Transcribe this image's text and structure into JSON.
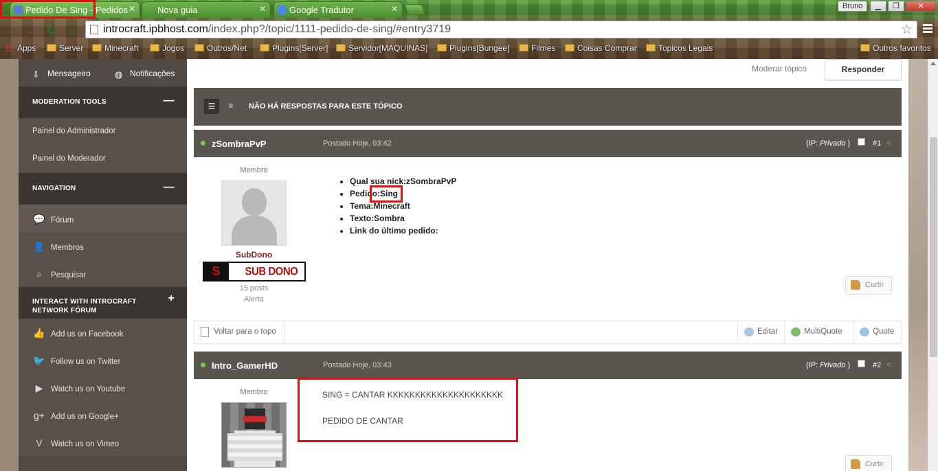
{
  "browser": {
    "tabs": [
      {
        "label": "Pedido De Sing - Pedidos",
        "active": true
      },
      {
        "label": "Nova guia",
        "active": false
      },
      {
        "label": "Google Tradutor",
        "active": false
      }
    ],
    "user": "Bruno",
    "window_buttons": {
      "minimize": "▁",
      "restore": "❐",
      "close": "✕"
    },
    "url_host": "introcraft.ipbhost.com",
    "url_path": "/index.php?/topic/1111-pedido-de-sing/#entry3719",
    "bookmarks": [
      "Apps",
      "Server",
      "Minecraft",
      "Jogos",
      "Outros/Net",
      "Plugins[Server]",
      "Servidor[MAQUINAS]",
      "Plugins[Bungee]",
      "Filmes",
      "Coisas Comprar",
      "Topicos Legais"
    ],
    "other_bookmarks": "Outros favoritos"
  },
  "sidebar": {
    "top_links": [
      {
        "label": "Mensageiro",
        "icon": "inbox-icon"
      },
      {
        "label": "Notificações",
        "icon": "globe-icon"
      }
    ],
    "moderation": {
      "title": "MODERATION TOOLS",
      "toggle": "—",
      "items": [
        "Painel do Administrador",
        "Painel do Moderador"
      ]
    },
    "navigation": {
      "title": "NAVIGATION",
      "toggle": "—",
      "items": [
        {
          "label": "Fórum",
          "icon": "chat-bubble-icon"
        },
        {
          "label": "Membros",
          "icon": "user-icon"
        },
        {
          "label": "Pesquisar",
          "icon": "search-icon"
        }
      ]
    },
    "interact": {
      "title": "INTERACT WITH INTROCRAFT NETWORK FÓRUM",
      "toggle": "+",
      "items": [
        {
          "label": "Add us on Facebook",
          "icon": "thumbs-up-icon"
        },
        {
          "label": "Follow us on Twitter",
          "icon": "twitter-bird-icon"
        },
        {
          "label": "Watch us on Youtube",
          "icon": "youtube-icon"
        },
        {
          "label": "Add us on Google+",
          "icon": "google-plus-icon"
        },
        {
          "label": "Watch us on Vimeo",
          "icon": "vimeo-icon"
        }
      ]
    }
  },
  "topic": {
    "moderate_label": "Moderar tópico",
    "reply_label": "Responder",
    "no_replies": "NÃO HÁ RESPOSTAS PARA ESTE TÓPICO"
  },
  "posts": [
    {
      "author": "zSombraPvP",
      "date": "Postado Hoje, 03:42",
      "ip_prefix": "(IP: ",
      "ip_value": "Privado",
      "ip_suffix": " )",
      "number": "#1",
      "role": "Membro",
      "group": "SubDono",
      "rank_letter": "S",
      "rank_text": "SUB DONO",
      "posts_count": "15 posts",
      "warn": "Alerta",
      "content_list": [
        "Qual sua nick:zSombraPvP",
        "Pedido:Sing",
        "Tema:Minecraft",
        "Texto:Sombra",
        "Link do último pedido:"
      ],
      "like_label": "Curtir"
    },
    {
      "author": "Intro_GamerHD",
      "date": "Postado Hoje, 03:43",
      "ip_prefix": "(IP: ",
      "ip_value": "Privado",
      "ip_suffix": " )",
      "number": "#2",
      "role": "Membro",
      "content_lines": [
        "SING = CANTAR KKKKKKKKKKKKKKKKKKKKK",
        "PEDIDO DE CANTAR"
      ],
      "like_label": "Curtir"
    }
  ],
  "post_footer": {
    "back_to_top": "Voltar para o topo",
    "edit": "Editar",
    "multiquote": "MultiQuote",
    "quote": "Quote"
  },
  "colors": {
    "sidebar_bg": "#595049",
    "header_bar": "#5b5550",
    "group_color": "#8a1c1c",
    "highlight_red": "#e01010"
  }
}
